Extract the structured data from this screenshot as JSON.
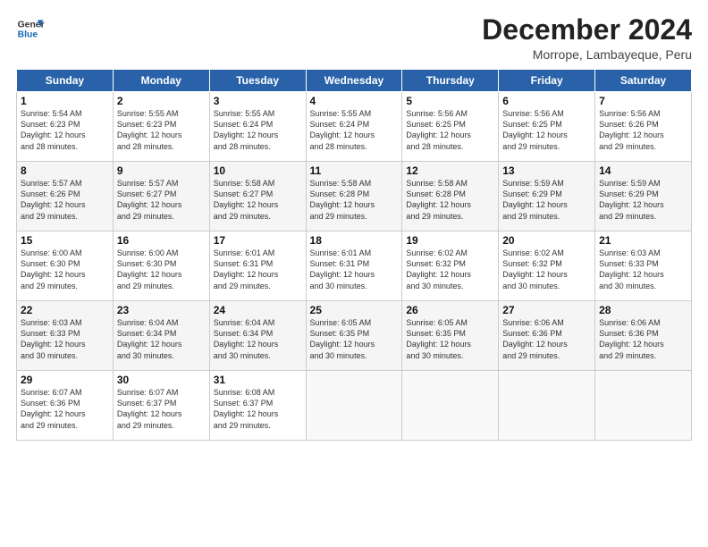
{
  "logo": {
    "line1": "General",
    "line2": "Blue"
  },
  "title": "December 2024",
  "subtitle": "Morrope, Lambayeque, Peru",
  "days_header": [
    "Sunday",
    "Monday",
    "Tuesday",
    "Wednesday",
    "Thursday",
    "Friday",
    "Saturday"
  ],
  "weeks": [
    [
      {
        "day": "1",
        "info": "Sunrise: 5:54 AM\nSunset: 6:23 PM\nDaylight: 12 hours\nand 28 minutes."
      },
      {
        "day": "2",
        "info": "Sunrise: 5:55 AM\nSunset: 6:23 PM\nDaylight: 12 hours\nand 28 minutes."
      },
      {
        "day": "3",
        "info": "Sunrise: 5:55 AM\nSunset: 6:24 PM\nDaylight: 12 hours\nand 28 minutes."
      },
      {
        "day": "4",
        "info": "Sunrise: 5:55 AM\nSunset: 6:24 PM\nDaylight: 12 hours\nand 28 minutes."
      },
      {
        "day": "5",
        "info": "Sunrise: 5:56 AM\nSunset: 6:25 PM\nDaylight: 12 hours\nand 28 minutes."
      },
      {
        "day": "6",
        "info": "Sunrise: 5:56 AM\nSunset: 6:25 PM\nDaylight: 12 hours\nand 29 minutes."
      },
      {
        "day": "7",
        "info": "Sunrise: 5:56 AM\nSunset: 6:26 PM\nDaylight: 12 hours\nand 29 minutes."
      }
    ],
    [
      {
        "day": "8",
        "info": "Sunrise: 5:57 AM\nSunset: 6:26 PM\nDaylight: 12 hours\nand 29 minutes."
      },
      {
        "day": "9",
        "info": "Sunrise: 5:57 AM\nSunset: 6:27 PM\nDaylight: 12 hours\nand 29 minutes."
      },
      {
        "day": "10",
        "info": "Sunrise: 5:58 AM\nSunset: 6:27 PM\nDaylight: 12 hours\nand 29 minutes."
      },
      {
        "day": "11",
        "info": "Sunrise: 5:58 AM\nSunset: 6:28 PM\nDaylight: 12 hours\nand 29 minutes."
      },
      {
        "day": "12",
        "info": "Sunrise: 5:58 AM\nSunset: 6:28 PM\nDaylight: 12 hours\nand 29 minutes."
      },
      {
        "day": "13",
        "info": "Sunrise: 5:59 AM\nSunset: 6:29 PM\nDaylight: 12 hours\nand 29 minutes."
      },
      {
        "day": "14",
        "info": "Sunrise: 5:59 AM\nSunset: 6:29 PM\nDaylight: 12 hours\nand 29 minutes."
      }
    ],
    [
      {
        "day": "15",
        "info": "Sunrise: 6:00 AM\nSunset: 6:30 PM\nDaylight: 12 hours\nand 29 minutes."
      },
      {
        "day": "16",
        "info": "Sunrise: 6:00 AM\nSunset: 6:30 PM\nDaylight: 12 hours\nand 29 minutes."
      },
      {
        "day": "17",
        "info": "Sunrise: 6:01 AM\nSunset: 6:31 PM\nDaylight: 12 hours\nand 29 minutes."
      },
      {
        "day": "18",
        "info": "Sunrise: 6:01 AM\nSunset: 6:31 PM\nDaylight: 12 hours\nand 30 minutes."
      },
      {
        "day": "19",
        "info": "Sunrise: 6:02 AM\nSunset: 6:32 PM\nDaylight: 12 hours\nand 30 minutes."
      },
      {
        "day": "20",
        "info": "Sunrise: 6:02 AM\nSunset: 6:32 PM\nDaylight: 12 hours\nand 30 minutes."
      },
      {
        "day": "21",
        "info": "Sunrise: 6:03 AM\nSunset: 6:33 PM\nDaylight: 12 hours\nand 30 minutes."
      }
    ],
    [
      {
        "day": "22",
        "info": "Sunrise: 6:03 AM\nSunset: 6:33 PM\nDaylight: 12 hours\nand 30 minutes."
      },
      {
        "day": "23",
        "info": "Sunrise: 6:04 AM\nSunset: 6:34 PM\nDaylight: 12 hours\nand 30 minutes."
      },
      {
        "day": "24",
        "info": "Sunrise: 6:04 AM\nSunset: 6:34 PM\nDaylight: 12 hours\nand 30 minutes."
      },
      {
        "day": "25",
        "info": "Sunrise: 6:05 AM\nSunset: 6:35 PM\nDaylight: 12 hours\nand 30 minutes."
      },
      {
        "day": "26",
        "info": "Sunrise: 6:05 AM\nSunset: 6:35 PM\nDaylight: 12 hours\nand 30 minutes."
      },
      {
        "day": "27",
        "info": "Sunrise: 6:06 AM\nSunset: 6:36 PM\nDaylight: 12 hours\nand 29 minutes."
      },
      {
        "day": "28",
        "info": "Sunrise: 6:06 AM\nSunset: 6:36 PM\nDaylight: 12 hours\nand 29 minutes."
      }
    ],
    [
      {
        "day": "29",
        "info": "Sunrise: 6:07 AM\nSunset: 6:36 PM\nDaylight: 12 hours\nand 29 minutes."
      },
      {
        "day": "30",
        "info": "Sunrise: 6:07 AM\nSunset: 6:37 PM\nDaylight: 12 hours\nand 29 minutes."
      },
      {
        "day": "31",
        "info": "Sunrise: 6:08 AM\nSunset: 6:37 PM\nDaylight: 12 hours\nand 29 minutes."
      },
      {
        "day": "",
        "info": ""
      },
      {
        "day": "",
        "info": ""
      },
      {
        "day": "",
        "info": ""
      },
      {
        "day": "",
        "info": ""
      }
    ]
  ]
}
